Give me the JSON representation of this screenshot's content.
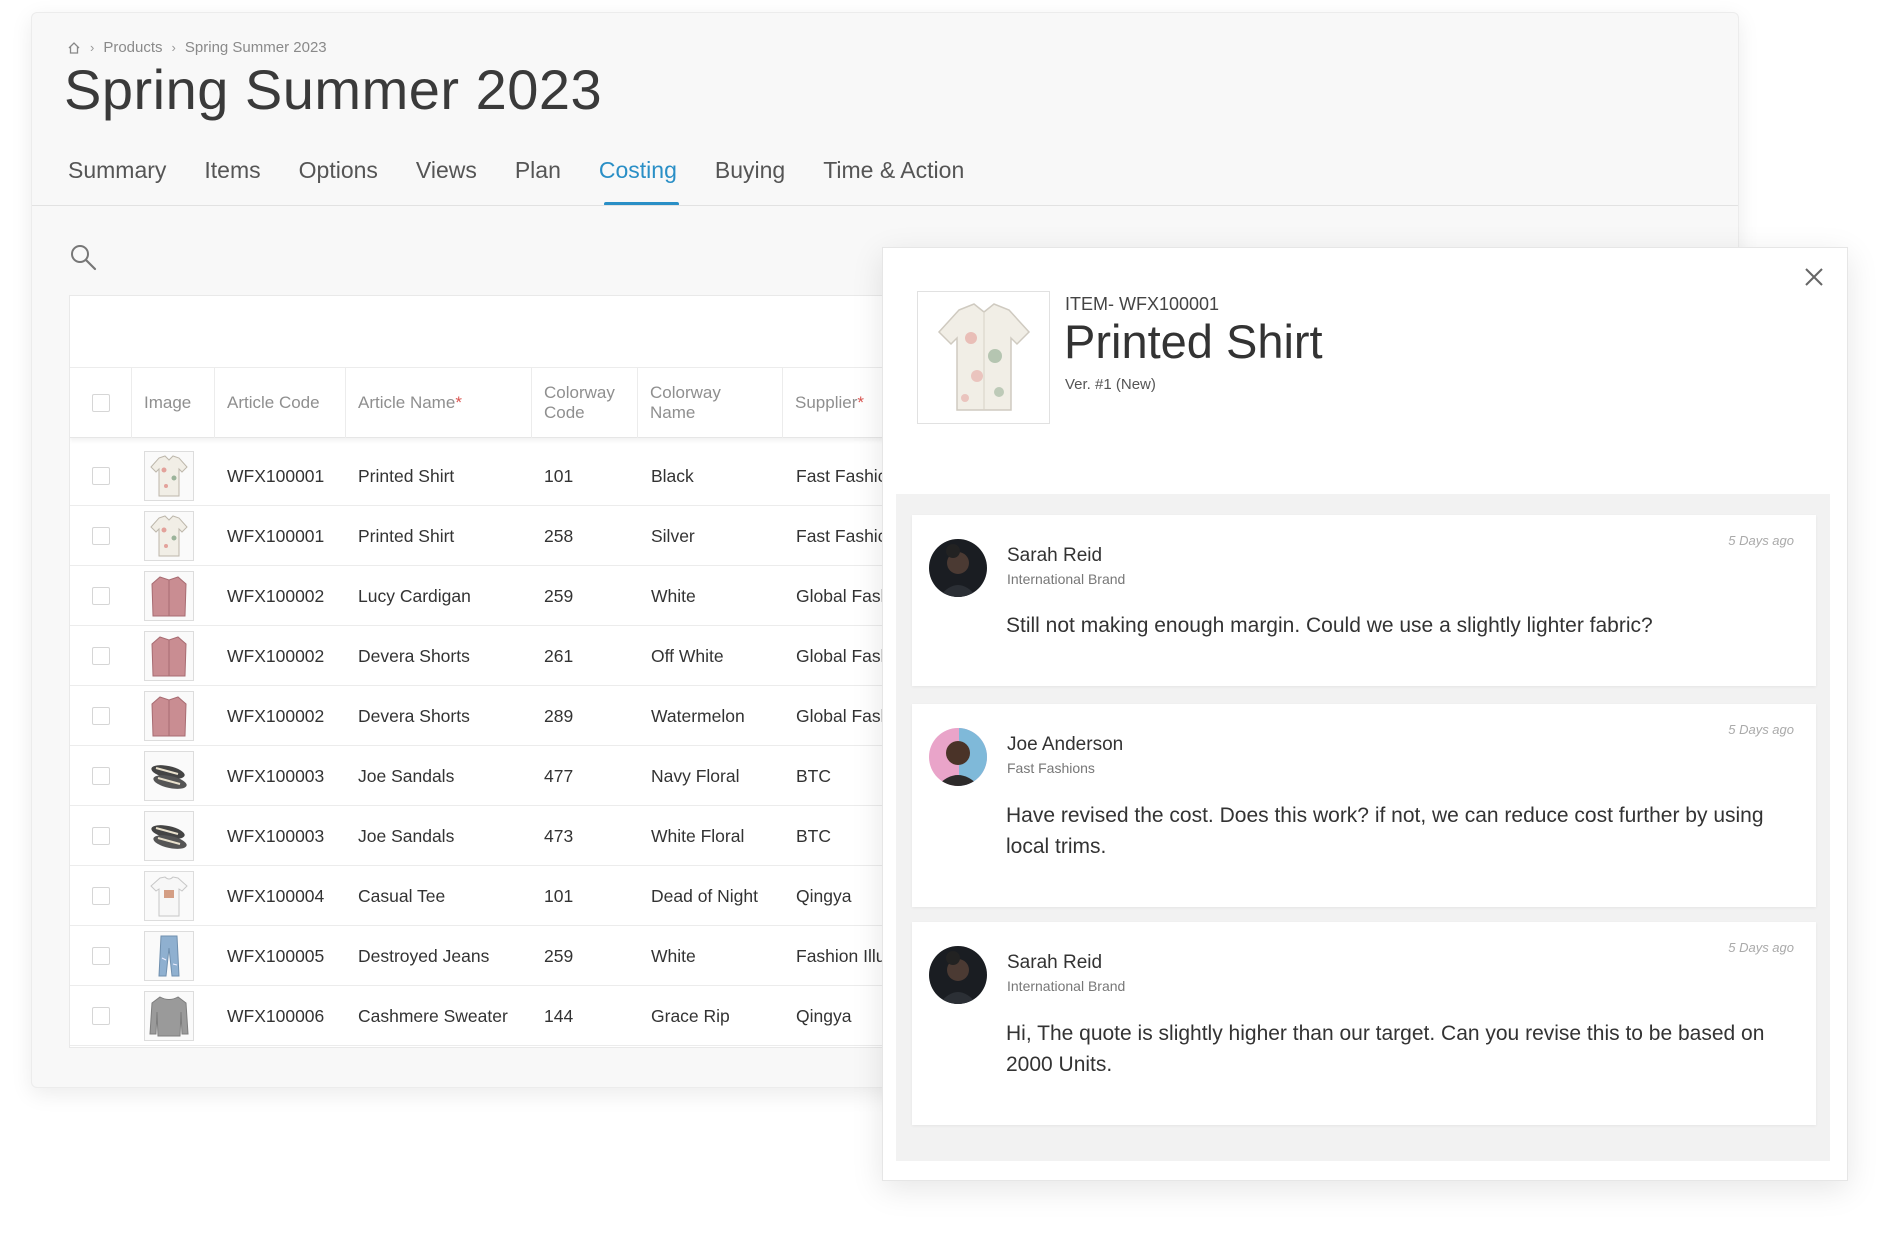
{
  "breadcrumb": {
    "items": [
      "Products",
      "Spring Summer 2023"
    ]
  },
  "page": {
    "title": "Spring Summer 2023"
  },
  "tabs": [
    {
      "label": "Summary"
    },
    {
      "label": "Items"
    },
    {
      "label": "Options"
    },
    {
      "label": "Views"
    },
    {
      "label": "Plan"
    },
    {
      "label": "Costing"
    },
    {
      "label": "Buying"
    },
    {
      "label": "Time & Action"
    }
  ],
  "active_tab": "Costing",
  "table": {
    "columns": {
      "image": "Image",
      "article_code": "Article Code",
      "article_name": "Article Name",
      "colorway_code_1": "Colorway",
      "colorway_code_2": "Code",
      "colorway_name_1": "Colorway",
      "colorway_name_2": "Name",
      "supplier": "Supplier",
      "required_marker": "*"
    },
    "rows": [
      {
        "thumb": "shirt-icon",
        "code": "WFX100001",
        "name": "Printed Shirt",
        "cw_code": "101",
        "cw_name": "Black",
        "supplier": "Fast Fashic"
      },
      {
        "thumb": "shirt-icon",
        "code": "WFX100001",
        "name": "Printed Shirt",
        "cw_code": "258",
        "cw_name": "Silver",
        "supplier": "Fast Fashic"
      },
      {
        "thumb": "cardigan-icon",
        "code": "WFX100002",
        "name": "Lucy Cardigan",
        "cw_code": "259",
        "cw_name": "White",
        "supplier": "Global Fasl"
      },
      {
        "thumb": "cardigan-icon",
        "code": "WFX100002",
        "name": "Devera Shorts",
        "cw_code": "261",
        "cw_name": "Off White",
        "supplier": "Global Fasl"
      },
      {
        "thumb": "cardigan-icon",
        "code": "WFX100002",
        "name": "Devera Shorts",
        "cw_code": "289",
        "cw_name": "Watermelon",
        "supplier": "Global Fasl"
      },
      {
        "thumb": "sandal-icon",
        "code": "WFX100003",
        "name": "Joe Sandals",
        "cw_code": "477",
        "cw_name": "Navy Floral",
        "supplier": "BTC"
      },
      {
        "thumb": "sandal-icon",
        "code": "WFX100003",
        "name": "Joe Sandals",
        "cw_code": "473",
        "cw_name": "White Floral",
        "supplier": "BTC"
      },
      {
        "thumb": "tee-icon",
        "code": "WFX100004",
        "name": "Casual Tee",
        "cw_code": "101",
        "cw_name": "Dead of Night",
        "supplier": "Qingya"
      },
      {
        "thumb": "jeans-icon",
        "code": "WFX100005",
        "name": "Destroyed Jeans",
        "cw_code": "259",
        "cw_name": "White",
        "supplier": "Fashion Illu"
      },
      {
        "thumb": "sweater-icon",
        "code": "WFX100006",
        "name": "Cashmere Sweater",
        "cw_code": "144",
        "cw_name": "Grace Rip",
        "supplier": "Qingya"
      }
    ]
  },
  "panel": {
    "item_code": "ITEM- WFX100001",
    "item_name": "Printed Shirt",
    "version": "Ver. #1 (New)",
    "comments": [
      {
        "name": "Sarah Reid",
        "org": "International Brand",
        "time": "5 Days ago",
        "text": "Still not making enough margin. Could we use a slightly lighter fabric?"
      },
      {
        "name": "Joe Anderson",
        "org": "Fast Fashions",
        "time": "5 Days ago",
        "text": "Have revised the cost. Does this work? if not, we can reduce cost further by using local trims."
      },
      {
        "name": "Sarah Reid",
        "org": "International Brand",
        "time": "5 Days ago",
        "text": "Hi, The quote is slightly higher than our target. Can you revise this to be based on 2000 Units."
      }
    ]
  },
  "colors": {
    "accent": "#2a8fc6",
    "required": "#d9534f"
  }
}
